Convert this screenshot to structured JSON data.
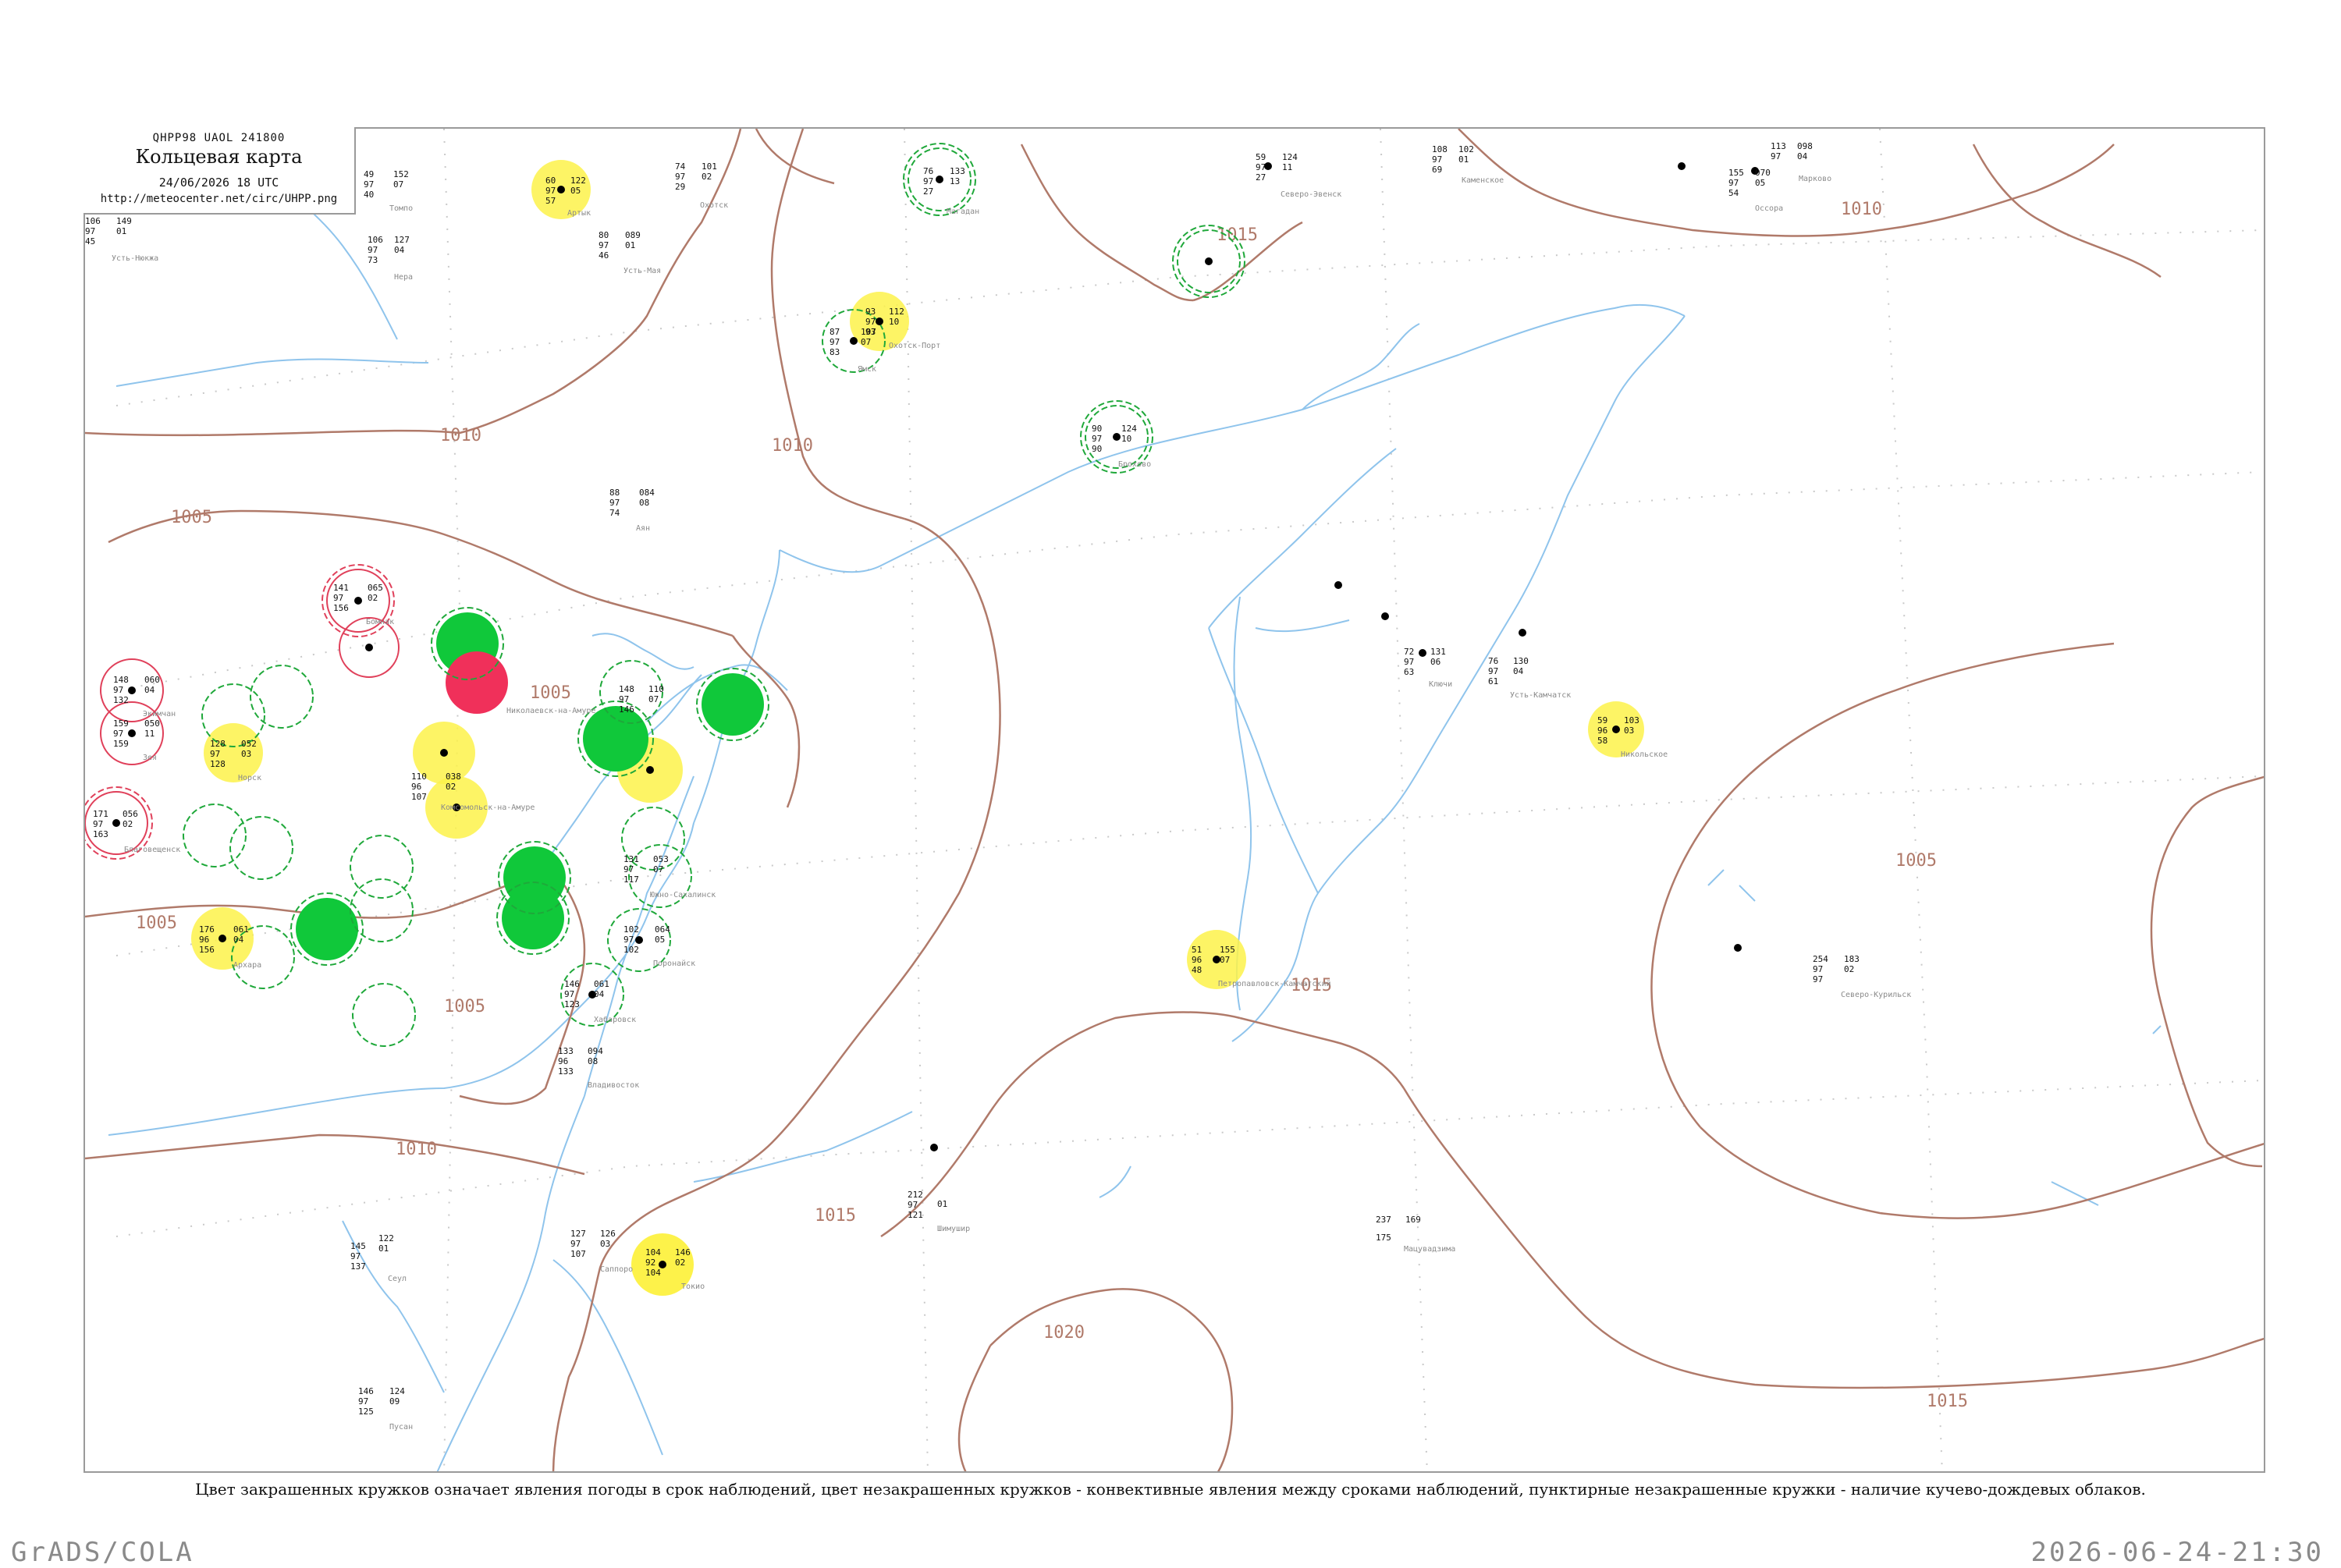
{
  "header": {
    "code": "QHPP98  UAOL  241800",
    "title": "Кольцевая карта",
    "datetime": "24/06/2026 18 UTC",
    "url": "http://meteocenter.net/circ/UHPP.png"
  },
  "caption": "Цвет закрашенных кружков означает явления погоды в срок наблюдений, цвет незакрашенных кружков - конвективные явления между сроками наблюдений, пунктирные незакрашенные кружки - наличие кучево-дождевых облаков.",
  "footer": {
    "left": "GrADS/COLA",
    "right": "2026-06-24-21:30"
  },
  "colors": {
    "isobar": "#b07a6a",
    "coast": "#8fc4ec",
    "green_fill": "#10c83a",
    "yellow_fill": "#fdf24a",
    "red_fill": "#f0305a",
    "green_ring": "#1fa83a",
    "red_ring": "#e0405a"
  },
  "isobar_labels": [
    "1010",
    "1015",
    "1010",
    "1005",
    "1005",
    "1005",
    "1010",
    "1005",
    "1015",
    "1015",
    "1020",
    "1015",
    "1005",
    "1010"
  ],
  "stations": [
    {
      "name": "Усть-Нюкжа",
      "values": [
        "106",
        "97",
        "45",
        "149",
        "01"
      ]
    },
    {
      "name": "Томпо",
      "values": [
        "49",
        "97",
        "40",
        "152",
        "07"
      ]
    },
    {
      "name": "Артык",
      "values": [
        "60",
        "97",
        "57",
        "122",
        "05"
      ]
    },
    {
      "name": "Усть-Мая",
      "values": [
        "80",
        "97",
        "46",
        "089",
        "01"
      ]
    },
    {
      "name": "Охотск",
      "values": [
        "74",
        "97",
        "29",
        "101",
        "02"
      ]
    },
    {
      "name": "Магадан",
      "values": [
        "76",
        "97",
        "27",
        "133",
        "13"
      ]
    },
    {
      "name": "Северо-Эвенск",
      "values": [
        "59",
        "97",
        "27",
        "124",
        "11"
      ]
    },
    {
      "name": "Каменское",
      "values": [
        "108",
        "97",
        "69",
        "102",
        "01"
      ]
    },
    {
      "name": "Марково",
      "values": [
        "113",
        "97",
        "098",
        "04"
      ]
    },
    {
      "name": "Оссора",
      "values": [
        "155",
        "97",
        "54",
        "070",
        "05"
      ]
    },
    {
      "name": "Нера",
      "values": [
        "106",
        "97",
        "73",
        "127",
        "04"
      ]
    },
    {
      "name": "Аян",
      "values": [
        "88",
        "97",
        "74",
        "084",
        "08"
      ]
    },
    {
      "name": "Охотск-Порт",
      "values": [
        "93",
        "97",
        "93",
        "112",
        "10"
      ]
    },
    {
      "name": "Ямск",
      "values": [
        "87",
        "97",
        "83",
        "107",
        "07"
      ]
    },
    {
      "name": "Брохово",
      "values": [
        "90",
        "97",
        "90",
        "124",
        "10"
      ]
    },
    {
      "name": "Бомнак",
      "values": [
        "141",
        "97",
        "156",
        "065",
        "02"
      ]
    },
    {
      "name": "Экимчан",
      "values": [
        "148",
        "97",
        "132",
        "060",
        "04"
      ]
    },
    {
      "name": "Зея",
      "values": [
        "159",
        "97",
        "159",
        "050",
        "11"
      ]
    },
    {
      "name": "Норск",
      "values": [
        "128",
        "97",
        "128",
        "052",
        "03"
      ]
    },
    {
      "name": "Благовещенск",
      "values": [
        "171",
        "97",
        "163",
        "056",
        "02"
      ]
    },
    {
      "name": "Архара",
      "values": [
        "176",
        "96",
        "156",
        "061",
        "04"
      ]
    },
    {
      "name": "Николаевск-на-Амуре",
      "values": [
        "148",
        "97",
        "146",
        "110",
        "07"
      ]
    },
    {
      "name": "Комсомольск-на-Амуре",
      "values": [
        "110",
        "96",
        "107",
        "038",
        "02"
      ]
    },
    {
      "name": "Хабаровск",
      "values": [
        "146",
        "97",
        "123",
        "061",
        "04"
      ]
    },
    {
      "name": "Владивосток",
      "values": [
        "133",
        "96",
        "133",
        "094",
        "08"
      ]
    },
    {
      "name": "Южно-Сахалинск",
      "values": [
        "131",
        "97",
        "117",
        "053",
        "07"
      ]
    },
    {
      "name": "Поронайск",
      "values": [
        "102",
        "97",
        "102",
        "064",
        "05"
      ]
    },
    {
      "name": "Ключи",
      "values": [
        "72",
        "97",
        "63",
        "131",
        "06"
      ]
    },
    {
      "name": "Петропавловск-Камчатский",
      "values": [
        "51",
        "96",
        "48",
        "155",
        "07"
      ]
    },
    {
      "name": "Усть-Камчатск",
      "values": [
        "76",
        "97",
        "61",
        "130",
        "04"
      ]
    },
    {
      "name": "Никольское",
      "values": [
        "59",
        "96",
        "58",
        "103",
        "03"
      ]
    },
    {
      "name": "Северо-Курильск",
      "values": [
        "254",
        "97",
        "97",
        "183",
        "02"
      ]
    },
    {
      "name": "Токио",
      "values": [
        "104",
        "92",
        "104",
        "146",
        "02"
      ]
    },
    {
      "name": "Саппоро",
      "values": [
        "127",
        "97",
        "107",
        "126",
        "03"
      ]
    },
    {
      "name": "Шимушир",
      "values": [
        "212",
        "97",
        "121",
        "01"
      ]
    },
    {
      "name": "Мацувадзима",
      "values": [
        "237",
        "175",
        "169"
      ]
    },
    {
      "name": "Сеул",
      "values": [
        "145",
        "97",
        "137",
        "122",
        "01"
      ]
    },
    {
      "name": "Пусан",
      "values": [
        "146",
        "97",
        "125",
        "124",
        "09"
      ]
    }
  ]
}
